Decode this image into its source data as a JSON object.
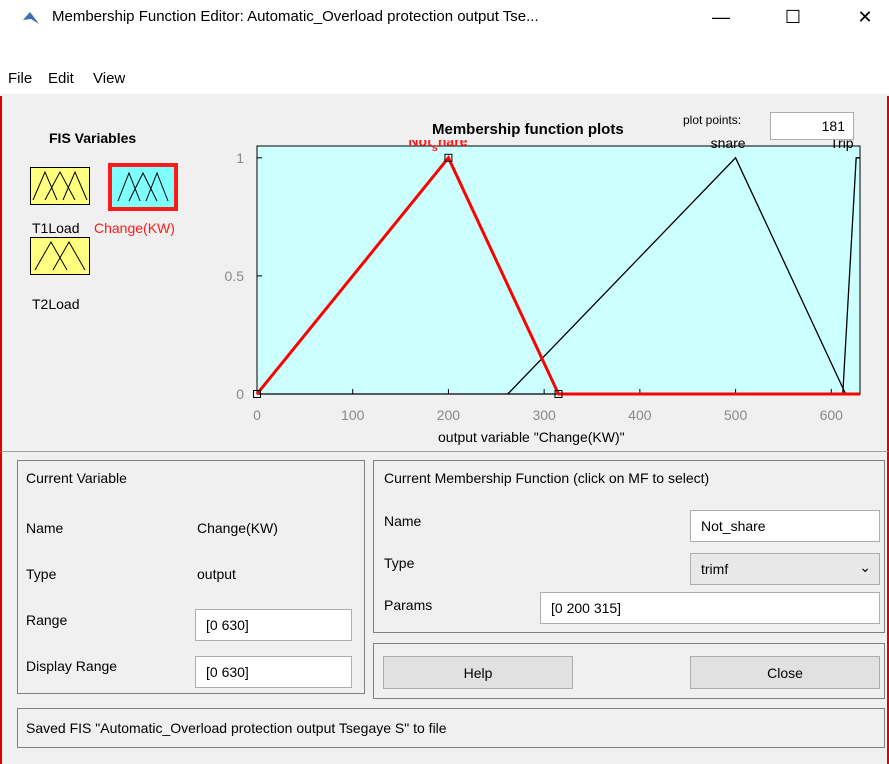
{
  "window": {
    "title": "Membership Function Editor: Automatic_Overload protection output Tse...",
    "minimize": "—",
    "maximize": "☐",
    "close": "✕"
  },
  "menu": {
    "file": "File",
    "edit": "Edit",
    "view": "View"
  },
  "fis_vars": {
    "heading": "FIS Variables",
    "items": [
      {
        "label": "T1Load",
        "selected": false
      },
      {
        "label": "Change(KW)",
        "selected": true
      },
      {
        "label": "T2Load",
        "selected": false
      }
    ]
  },
  "plot": {
    "title": "Membership function plots",
    "plot_points_label": "plot points:",
    "plot_points_value": "181",
    "xlabel": "output variable \"Change(KW)\""
  },
  "chart_data": {
    "type": "line",
    "xlim": [
      0,
      630
    ],
    "ylim": [
      0,
      1.05
    ],
    "x_ticks": [
      0,
      100,
      200,
      300,
      400,
      500,
      600
    ],
    "y_ticks": [
      0,
      0.5,
      1
    ],
    "y_tick_labels": [
      "0",
      "0.5",
      "1"
    ],
    "series": [
      {
        "name": "Not_share",
        "display_label": "Not",
        "display_sub": "s",
        "display_label2": "hare",
        "x": [
          0,
          200,
          315,
          630
        ],
        "y": [
          0,
          1,
          0,
          0
        ],
        "color": "#ff0000"
      },
      {
        "name": "share",
        "x": [
          262,
          500,
          615
        ],
        "y": [
          0,
          1,
          0
        ],
        "color": "#000000"
      },
      {
        "name": "Trip",
        "x": [
          0,
          612,
          626,
          630
        ],
        "y": [
          0,
          0,
          1,
          1
        ],
        "color": "#000000"
      }
    ],
    "background": "#ccffff"
  },
  "current_variable": {
    "heading": "Current Variable",
    "name_label": "Name",
    "name_value": "Change(KW)",
    "type_label": "Type",
    "type_value": "output",
    "range_label": "Range",
    "range_value": "[0 630]",
    "display_range_label": "Display Range",
    "display_range_value": "[0 630]"
  },
  "current_mf": {
    "heading": "Current Membership Function (click on MF to select)",
    "name_label": "Name",
    "name_value": "Not_share",
    "type_label": "Type",
    "type_value": "trimf",
    "params_label": "Params",
    "params_value": "[0 200 315]"
  },
  "buttons": {
    "help": "Help",
    "close": "Close"
  },
  "status": "Saved FIS \"Automatic_Overload protection output Tsegaye S\" to file"
}
